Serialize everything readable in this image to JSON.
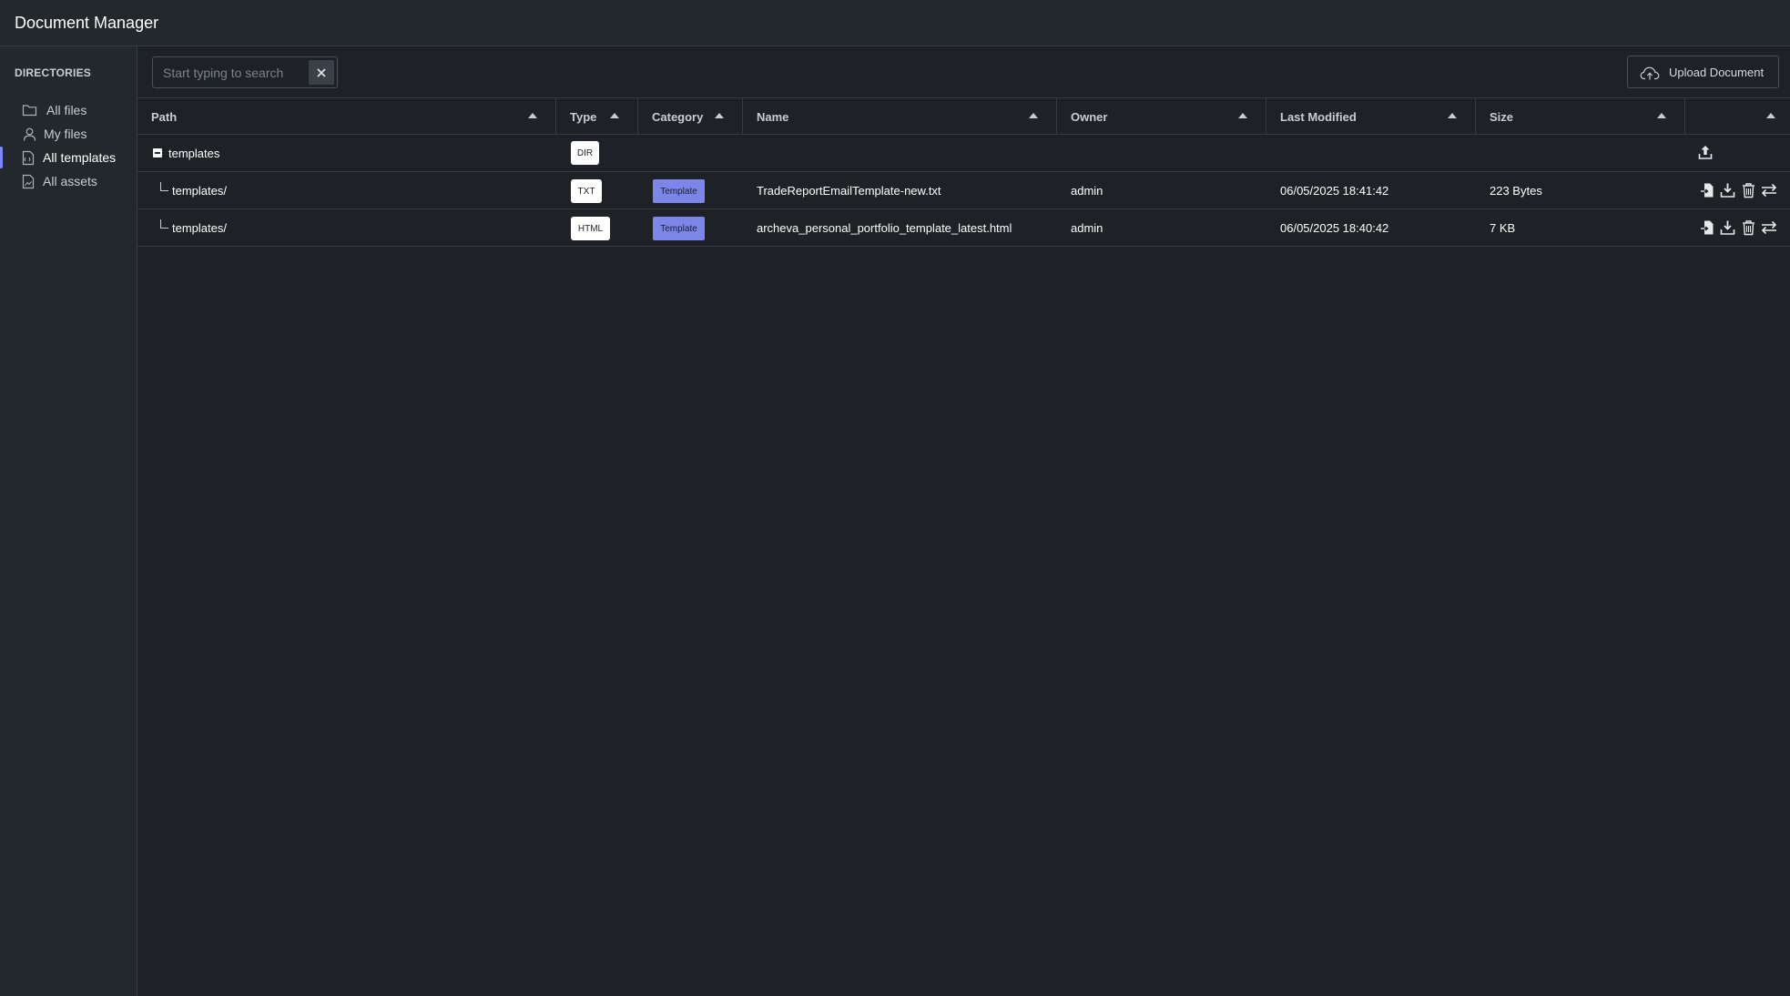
{
  "app": {
    "title": "Document Manager"
  },
  "sidebar": {
    "heading": "DIRECTORIES",
    "items": [
      {
        "label": "All files",
        "icon": "folder-icon",
        "active": false
      },
      {
        "label": "My files",
        "icon": "user-icon",
        "active": false
      },
      {
        "label": "All templates",
        "icon": "template-file-icon",
        "active": true
      },
      {
        "label": "All assets",
        "icon": "asset-file-icon",
        "active": false
      }
    ]
  },
  "toolbar": {
    "search_placeholder": "Start typing to search",
    "search_value": "",
    "upload_label": "Upload Document"
  },
  "table": {
    "columns": [
      "Path",
      "Type",
      "Category",
      "Name",
      "Owner",
      "Last Modified",
      "Size",
      ""
    ],
    "rows": [
      {
        "path": "templates",
        "type": "DIR",
        "category": "",
        "name": "",
        "owner": "",
        "modified": "",
        "size": "",
        "is_dir": true
      },
      {
        "path": "templates/",
        "type": "TXT",
        "category": "Template",
        "name": "TradeReportEmailTemplate-new.txt",
        "owner": "admin",
        "modified": "06/05/2025 18:41:42",
        "size": "223 Bytes",
        "is_dir": false
      },
      {
        "path": "templates/",
        "type": "HTML",
        "category": "Template",
        "name": "archeva_personal_portfolio_template_latest.html",
        "owner": "admin",
        "modified": "06/05/2025 18:40:42",
        "size": "7 KB",
        "is_dir": false
      }
    ]
  },
  "colors": {
    "background": "#1e2227",
    "panel": "#23282d",
    "accent": "#7b86ff",
    "category_badge": "#7b86e8"
  }
}
